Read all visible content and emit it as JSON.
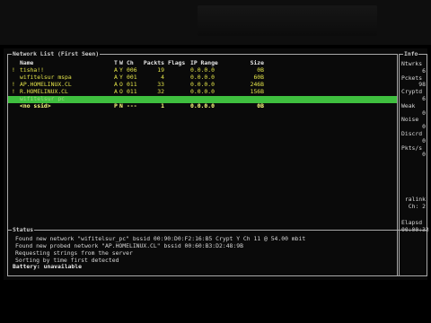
{
  "network_list": {
    "title": "Network List (First Seen)",
    "columns": {
      "name": "Name",
      "t": "T",
      "w": "W",
      "ch": "Ch",
      "packets": "Packts",
      "flags": "Flags",
      "ip": "IP Range",
      "size": "Size"
    },
    "rows": [
      {
        "flag": "!",
        "name": "tisha!!",
        "t": "A",
        "w": "Y",
        "ch": "006",
        "packets": "19",
        "flags": "",
        "ip": "0.0.0.0",
        "size": "0B",
        "style": "yellow"
      },
      {
        "flag": "",
        "name": "wifitelsur_mspa",
        "t": "A",
        "w": "Y",
        "ch": "001",
        "packets": "4",
        "flags": "",
        "ip": "0.0.0.0",
        "size": "60B",
        "style": "yellow"
      },
      {
        "flag": "!",
        "name": "AP.HOMELINUX.CL",
        "t": "A",
        "w": "O",
        "ch": "011",
        "packets": "33",
        "flags": "",
        "ip": "0.0.0.0",
        "size": "246B",
        "style": "yellow"
      },
      {
        "flag": "!",
        "name": "R.HOMELINUX.CL",
        "t": "A",
        "w": "O",
        "ch": "011",
        "packets": "32",
        "flags": "",
        "ip": "0.0.0.0",
        "size": "156B",
        "style": "yellow"
      },
      {
        "flag": "",
        "name": "wifitelsur_pc",
        "t": "",
        "w": "",
        "ch": "",
        "packets": "",
        "flags": "",
        "ip": "",
        "size": "",
        "style": "selected"
      },
      {
        "flag": "",
        "name": "<no ssid>",
        "t": "P",
        "w": "N",
        "ch": "---",
        "packets": "1",
        "flags": "",
        "ip": "0.0.0.0",
        "size": "0B",
        "style": "bold"
      }
    ]
  },
  "info": {
    "title": "Info",
    "lines": [
      {
        "text": "Ntwrks",
        "kind": "lbl"
      },
      {
        "text": "6",
        "kind": "val"
      },
      {
        "text": "Pckets",
        "kind": "lbl"
      },
      {
        "text": "98",
        "kind": "val"
      },
      {
        "text": "Cryptd",
        "kind": "lbl"
      },
      {
        "text": "6",
        "kind": "val"
      },
      {
        "text": "Weak",
        "kind": "lbl"
      },
      {
        "text": "0",
        "kind": "val"
      },
      {
        "text": "Noise",
        "kind": "lbl"
      },
      {
        "text": "0",
        "kind": "val"
      },
      {
        "text": "Discrd",
        "kind": "lbl"
      },
      {
        "text": "0",
        "kind": "val"
      },
      {
        "text": "Pkts/s",
        "kind": "lbl"
      },
      {
        "text": "0",
        "kind": "val"
      }
    ],
    "source_name": "ralink",
    "channel": "Ch:  2",
    "elapsed_label": "Elapsd",
    "elapsed": "00:00:33"
  },
  "status": {
    "title": "Status",
    "lines": [
      "Found new network \"wifitelsur_pc\" bssid 00:90:D0:F2:16:B5 Crypt Y Ch 11 @ 54.00 mbit",
      "Found new probed network \"AP.HOMELINUX.CL\" bssid 00:60:B3:D2:48:9B",
      "Requesting strings from the server",
      "Sorting by time first detected"
    ],
    "battery": "Battery: unavailable"
  }
}
